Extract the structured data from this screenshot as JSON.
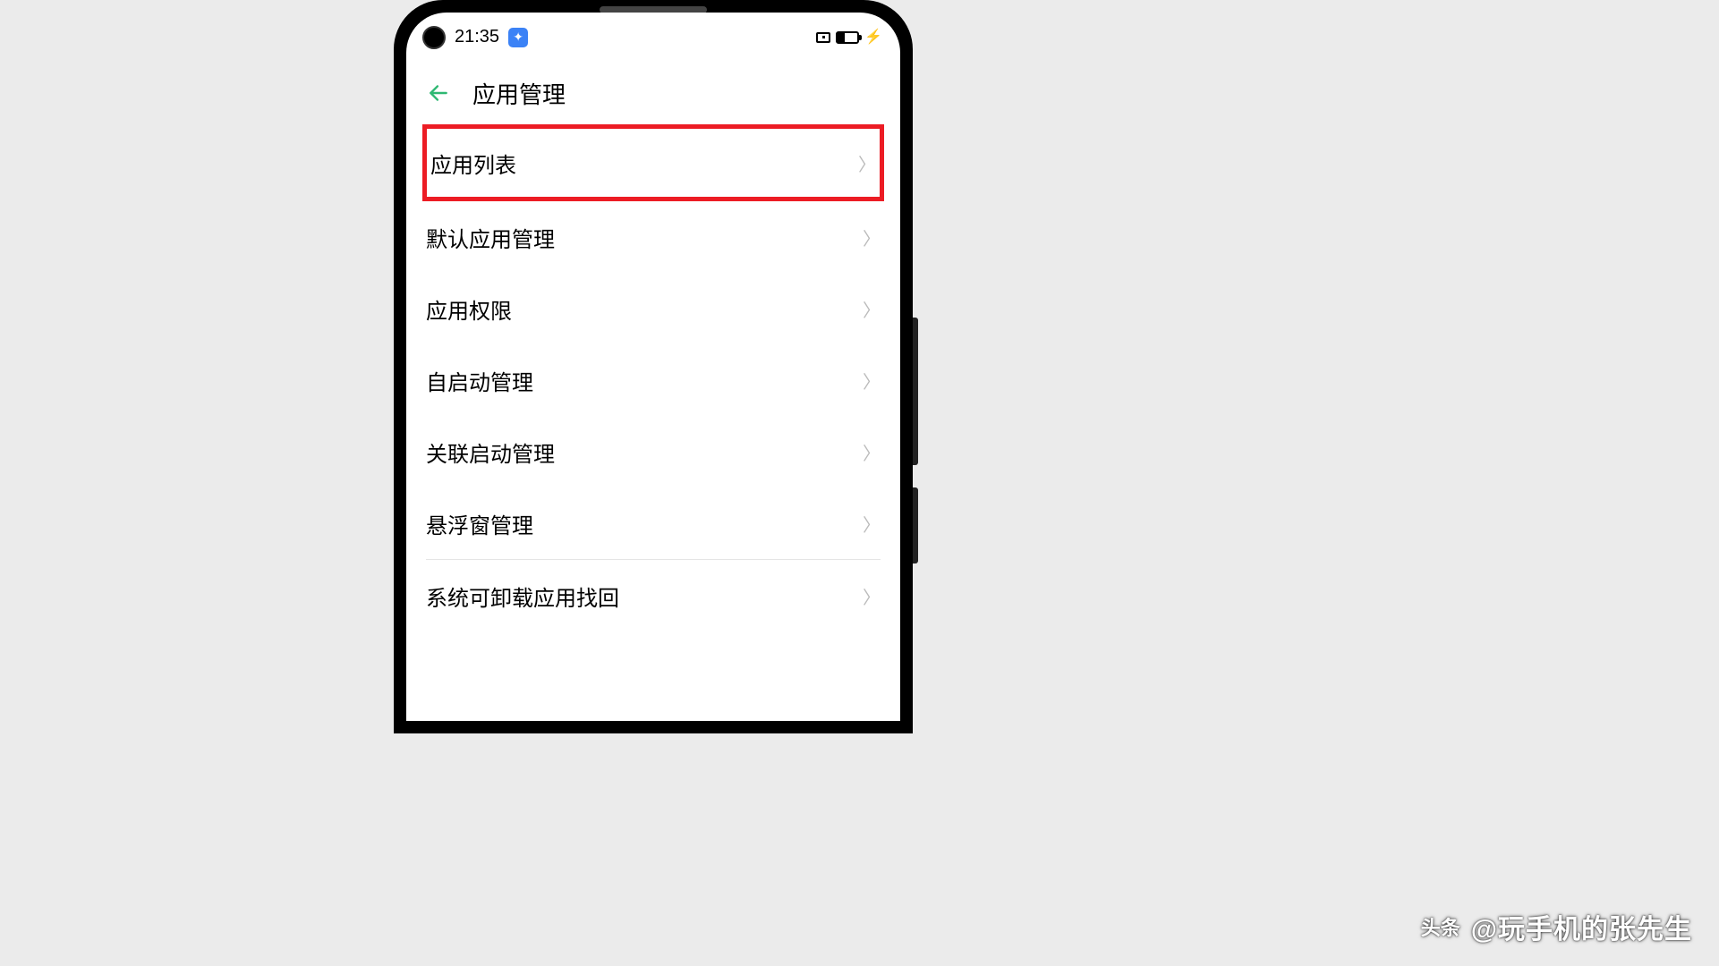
{
  "statusBar": {
    "time": "21:35",
    "appIndicator": "✦"
  },
  "header": {
    "title": "应用管理"
  },
  "menu": {
    "items": [
      {
        "label": "应用列表",
        "highlighted": true
      },
      {
        "label": "默认应用管理",
        "highlighted": false
      },
      {
        "label": "应用权限",
        "highlighted": false
      },
      {
        "label": "自启动管理",
        "highlighted": false
      },
      {
        "label": "关联启动管理",
        "highlighted": false
      },
      {
        "label": "悬浮窗管理",
        "highlighted": false
      }
    ],
    "secondaryItems": [
      {
        "label": "系统可卸载应用找回"
      }
    ]
  },
  "watermark": {
    "logo": "头条",
    "text": "@玩手机的张先生"
  }
}
